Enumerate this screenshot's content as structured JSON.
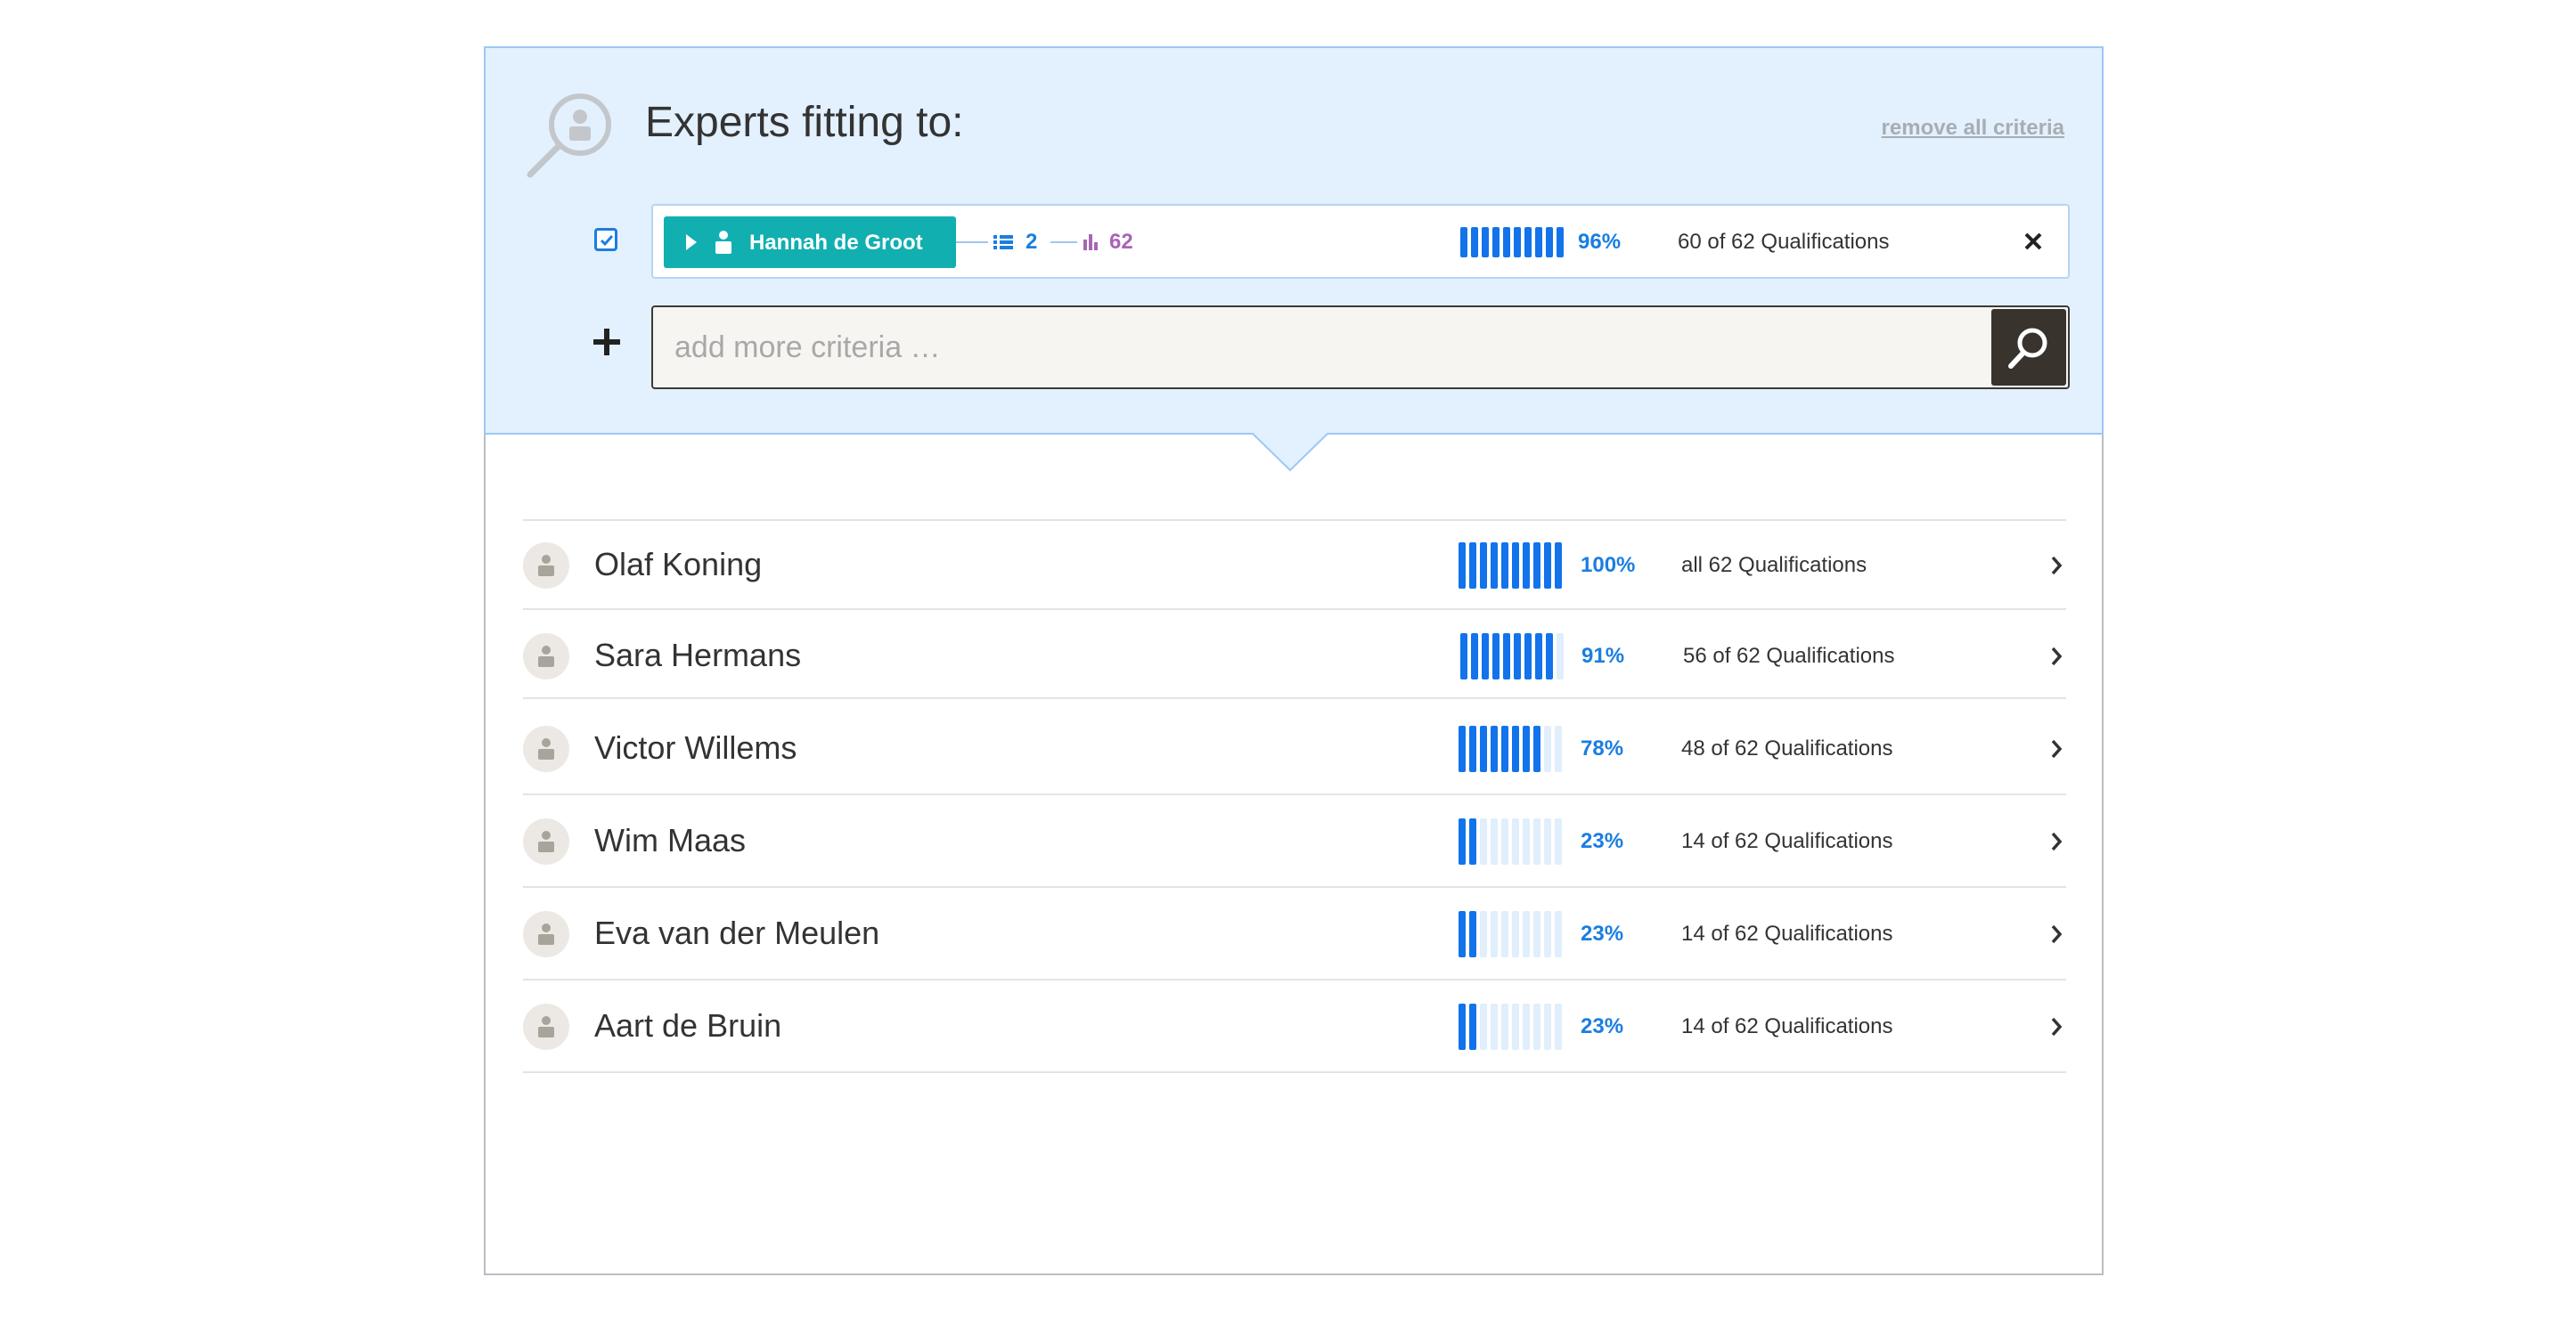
{
  "header": {
    "title": "Experts fitting to:",
    "remove_all_label": "remove all criteria"
  },
  "criterion": {
    "checked": true,
    "person_name": "Hannah de Groot",
    "list_count": "2",
    "chart_count": "62",
    "match_fraction": 0.96,
    "match_percent": "96%",
    "qualifications": "60 of 62 Qualifications",
    "remove_icon": "close-icon"
  },
  "search": {
    "placeholder": "add more criteria …",
    "value": ""
  },
  "results": [
    {
      "name": "Olaf Koning",
      "percent": "100%",
      "fraction": 1.0,
      "qualifications": "all 62 Qualifications"
    },
    {
      "name": "Sara Hermans",
      "percent": "91%",
      "fraction": 0.91,
      "qualifications": "56 of 62 Qualifications"
    },
    {
      "name": "Victor Willems",
      "percent": "78%",
      "fraction": 0.78,
      "qualifications": "48 of 62 Qualifications"
    },
    {
      "name": "Wim Maas",
      "percent": "23%",
      "fraction": 0.23,
      "qualifications": "14 of 62 Qualifications"
    },
    {
      "name": "Eva van der Meulen",
      "percent": "23%",
      "fraction": 0.23,
      "qualifications": "14 of 62 Qualifications"
    },
    {
      "name": "Aart de Bruin",
      "percent": "23%",
      "fraction": 0.23,
      "qualifications": "14 of 62 Qualifications"
    }
  ],
  "colors": {
    "accent_blue": "#1273ea",
    "chip_teal": "#12afb1",
    "chart_purple": "#a964b4",
    "panel_bg": "#e3f0fd",
    "search_button": "#38332d"
  }
}
